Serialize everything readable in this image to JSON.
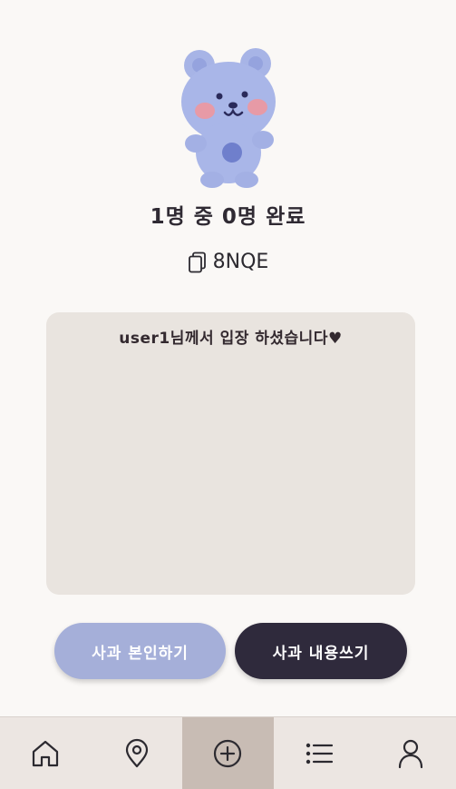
{
  "header": {
    "progress_text": "1명 중 0명 완료",
    "room_code": "8NQE"
  },
  "chat": {
    "messages": [
      "user1님께서 입장 하셨습니다♥"
    ]
  },
  "actions": {
    "confirm_label": "사과 본인하기",
    "write_label": "사과 내용쓰기"
  },
  "nav": {
    "items": [
      {
        "icon": "home-icon",
        "active": false
      },
      {
        "icon": "map-pin-icon",
        "active": false
      },
      {
        "icon": "plus-circle-icon",
        "active": true
      },
      {
        "icon": "list-icon",
        "active": false
      },
      {
        "icon": "user-icon",
        "active": false
      }
    ]
  },
  "colors": {
    "background": "#faf8f6",
    "chat_box": "#e9e4df",
    "confirm_button": "#a5afd9",
    "write_button": "#2f2a3c",
    "nav_bar": "#ece6e2",
    "nav_active": "#c8bcb4",
    "bear": "#a9b6e8"
  }
}
